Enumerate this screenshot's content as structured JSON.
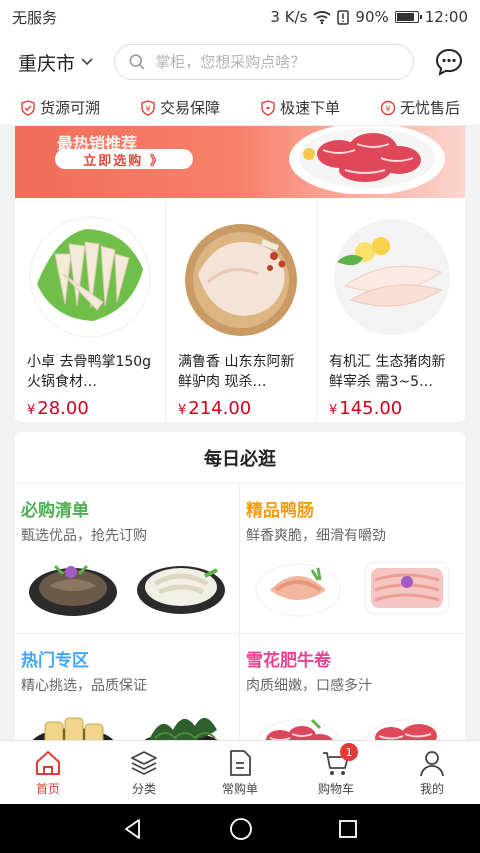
{
  "status_bar": {
    "carrier": "无服务",
    "speed": "3 K/s",
    "battery": "90%",
    "time": "12:00"
  },
  "header": {
    "city": "重庆市",
    "search_placeholder": "掌柜，您想采购点啥？"
  },
  "features": [
    {
      "label": "货源可溯",
      "icon": "shield-check-icon"
    },
    {
      "label": "交易保障",
      "icon": "currency-shield-icon"
    },
    {
      "label": "极速下单",
      "icon": "lightning-shield-icon"
    },
    {
      "label": "无忧售后",
      "icon": "currency-circle-icon"
    }
  ],
  "banner": {
    "button": "立即选购 》",
    "partial_title": "最热销推荐"
  },
  "products": [
    {
      "name": "小卓 去骨鸭掌150g 火锅食材…",
      "currency": "¥",
      "price": "28.00"
    },
    {
      "name": "满鲁香 山东东阿新鲜驴肉 现杀…",
      "currency": "¥",
      "price": "214.00"
    },
    {
      "name": "有机汇 生态猪肉新鲜宰杀 需3~5…",
      "currency": "¥",
      "price": "145.00"
    }
  ],
  "daily": {
    "title": "每日必逛",
    "cells": [
      {
        "title": "必购清单",
        "subtitle": "甄选优品，抢先订购",
        "color": "#4caf50"
      },
      {
        "title": "精品鸭肠",
        "subtitle": "鲜香爽脆，细滑有嚼劲",
        "color": "#f39c12"
      },
      {
        "title": "热门专区",
        "subtitle": "精心挑选，品质保证",
        "color": "#42a5f5"
      },
      {
        "title": "雪花肥牛卷",
        "subtitle": "肉质细嫩，口感多汁",
        "color": "#e84393"
      }
    ]
  },
  "bottom_nav": [
    {
      "label": "首页",
      "icon": "home-icon",
      "active": true
    },
    {
      "label": "分类",
      "icon": "layers-icon"
    },
    {
      "label": "常购单",
      "icon": "document-icon"
    },
    {
      "label": "购物车",
      "icon": "cart-icon",
      "badge": "1"
    },
    {
      "label": "我的",
      "icon": "user-icon"
    }
  ],
  "colors": {
    "accent": "#e53935",
    "price": "#d0021b"
  }
}
